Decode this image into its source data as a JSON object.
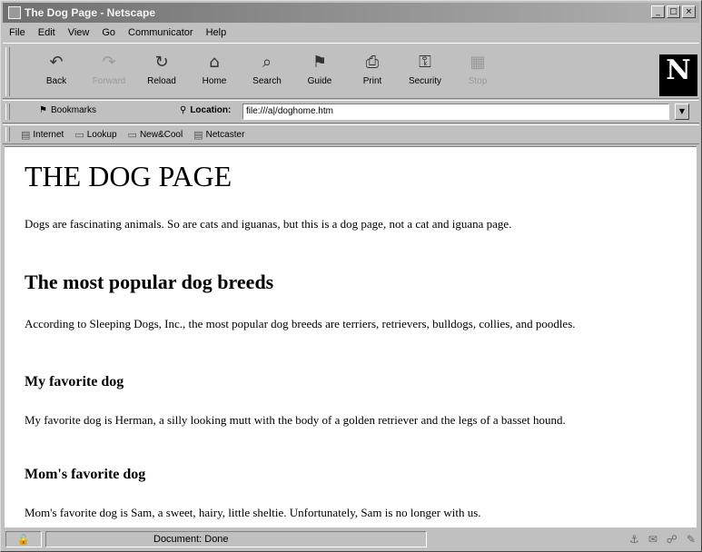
{
  "window": {
    "title": "The Dog Page - Netscape"
  },
  "menu": [
    "File",
    "Edit",
    "View",
    "Go",
    "Communicator",
    "Help"
  ],
  "toolbar": [
    {
      "label": "Back",
      "icon": "back-icon",
      "glyph": "↶",
      "enabled": true
    },
    {
      "label": "Forward",
      "icon": "forward-icon",
      "glyph": "↷",
      "enabled": false
    },
    {
      "label": "Reload",
      "icon": "reload-icon",
      "glyph": "↻",
      "enabled": true
    },
    {
      "label": "Home",
      "icon": "home-icon",
      "glyph": "⌂",
      "enabled": true
    },
    {
      "label": "Search",
      "icon": "search-icon",
      "glyph": "⌕",
      "enabled": true
    },
    {
      "label": "Guide",
      "icon": "guide-icon",
      "glyph": "⚑",
      "enabled": true
    },
    {
      "label": "Print",
      "icon": "print-icon",
      "glyph": "⎙",
      "enabled": true
    },
    {
      "label": "Security",
      "icon": "security-icon",
      "glyph": "⚿",
      "enabled": true
    },
    {
      "label": "Stop",
      "icon": "stop-icon",
      "glyph": "▦",
      "enabled": false
    }
  ],
  "logo": "N",
  "location": {
    "bookmarks_label": "Bookmarks",
    "label": "Location:",
    "url": "file:///a|/doghome.htm"
  },
  "personal_toolbar": [
    "Internet",
    "Lookup",
    "New&Cool",
    "Netcaster"
  ],
  "page": {
    "heading": "THE DOG PAGE",
    "intro": "Dogs are fascinating animals. So are cats and iguanas, but this is a dog page, not a cat and iguana page.",
    "breeds_heading": "The most popular dog breeds",
    "breeds_text": "According to Sleeping Dogs, Inc., the most popular dog breeds are terriers, retrievers, bulldogs, collies, and poodles.",
    "my_fav_heading": "My favorite dog",
    "my_fav_text": "My favorite dog is Herman, a silly looking mutt with the body of a golden retriever and the legs of a basset hound.",
    "mom_fav_heading": "Mom's favorite dog",
    "mom_fav_text": "Mom's favorite dog is Sam, a sweet, hairy, little sheltie. Unfortunately, Sam is no longer with us."
  },
  "status": {
    "text": "Document: Done"
  },
  "colors": {
    "background": "#c0c0c0",
    "content_bg": "#ffffff",
    "title_gradient_start": "#707070"
  }
}
